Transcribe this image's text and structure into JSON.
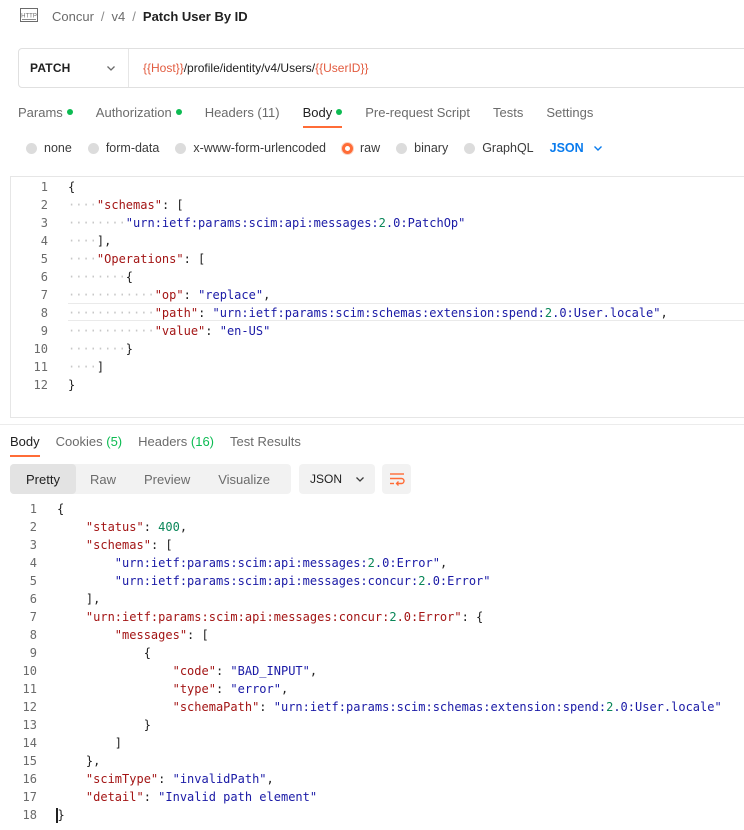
{
  "breadcrumb": {
    "icon": "http-icon",
    "collection": "Concur",
    "folder": "v4",
    "request_name": "Patch User By ID"
  },
  "request": {
    "method": "PATCH",
    "url_host_var": "{{Host}}",
    "url_path": "/profile/identity/v4/Users/",
    "url_id_var": "{{UserID}}"
  },
  "request_tabs": [
    {
      "label": "Params",
      "dot": true
    },
    {
      "label": "Authorization",
      "dot": true
    },
    {
      "label": "Headers (11)",
      "dot": false
    },
    {
      "label": "Body",
      "dot": true,
      "active": true
    },
    {
      "label": "Pre-request Script",
      "dot": false
    },
    {
      "label": "Tests",
      "dot": false
    },
    {
      "label": "Settings",
      "dot": false
    }
  ],
  "body_modes": [
    "none",
    "form-data",
    "x-www-form-urlencoded",
    "raw",
    "binary",
    "GraphQL"
  ],
  "body_mode_selected": "raw",
  "body_format": "JSON",
  "request_body_lines": [
    "{",
    "    \"schemas\": [",
    "        \"urn:ietf:params:scim:api:messages:2.0:PatchOp\"",
    "    ],",
    "    \"Operations\": [",
    "        {",
    "            \"op\": \"replace\",",
    "            \"path\": \"urn:ietf:params:scim:schemas:extension:spend:2.0:User.locale\",",
    "            \"value\": \"en-US\"",
    "        }",
    "    ]",
    "}"
  ],
  "response_tabs": [
    {
      "label": "Body",
      "active": true
    },
    {
      "label": "Cookies",
      "count": "(5)"
    },
    {
      "label": "Headers",
      "count": "(16)"
    },
    {
      "label": "Test Results"
    }
  ],
  "response_views": [
    "Pretty",
    "Raw",
    "Preview",
    "Visualize"
  ],
  "response_view_selected": "Pretty",
  "response_format": "JSON",
  "response_body_lines": [
    "{",
    "    \"status\": 400,",
    "    \"schemas\": [",
    "        \"urn:ietf:params:scim:api:messages:2.0:Error\",",
    "        \"urn:ietf:params:scim:api:messages:concur:2.0:Error\"",
    "    ],",
    "    \"urn:ietf:params:scim:api:messages:concur:2.0:Error\": {",
    "        \"messages\": [",
    "            {",
    "                \"code\": \"BAD_INPUT\",",
    "                \"type\": \"error\",",
    "                \"schemaPath\": \"urn:ietf:params:scim:schemas:extension:spend:2.0:User.locale\"",
    "            }",
    "        ]",
    "    },",
    "    \"scimType\": \"invalidPath\",",
    "    \"detail\": \"Invalid path element\"",
    "}"
  ],
  "colors": {
    "accent": "#ff6c37",
    "active_dot": "#0cbb52",
    "link_blue": "#097bed",
    "variable": "#e25b3f",
    "json_key": "#a31515",
    "json_string": "#1a1aa6",
    "json_number": "#098658"
  }
}
